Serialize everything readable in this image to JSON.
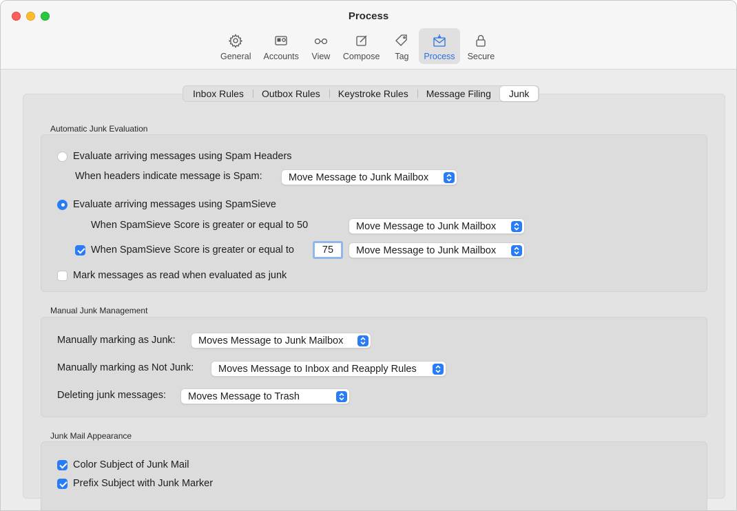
{
  "window": {
    "title": "Process"
  },
  "toolbar": {
    "items": [
      {
        "label": "General",
        "icon": "gear-icon"
      },
      {
        "label": "Accounts",
        "icon": "id-card-icon"
      },
      {
        "label": "View",
        "icon": "glasses-icon"
      },
      {
        "label": "Compose",
        "icon": "compose-icon"
      },
      {
        "label": "Tag",
        "icon": "tag-icon"
      },
      {
        "label": "Process",
        "icon": "mail-process-icon",
        "active": true
      },
      {
        "label": "Secure",
        "icon": "lock-icon"
      }
    ]
  },
  "tabs": [
    "Inbox Rules",
    "Outbox Rules",
    "Keystroke Rules",
    "Message Filing",
    "Junk"
  ],
  "active_tab": "Junk",
  "auto": {
    "heading": "Automatic Junk Evaluation",
    "spam_headers_radio": "Evaluate arriving messages using Spam Headers",
    "spam_headers_label": "When headers indicate message is Spam:",
    "spam_headers_action": "Move Message to Junk Mailbox",
    "spamsieve_radio": "Evaluate arriving messages using SpamSieve",
    "score1_label": "When SpamSieve Score is greater or equal to 50",
    "score1_action": "Move Message to Junk Mailbox",
    "score2_label": "When SpamSieve Score is greater or equal to",
    "score2_value": "75",
    "score2_action": "Move Message to Junk Mailbox",
    "mark_read": "Mark messages as read when evaluated as junk"
  },
  "manual": {
    "heading": "Manual Junk Management",
    "junk_label": "Manually marking as Junk:",
    "junk_action": "Moves Message to Junk Mailbox",
    "notjunk_label": "Manually marking as Not Junk:",
    "notjunk_action": "Moves Message to Inbox and Reapply Rules",
    "delete_label": "Deleting junk messages:",
    "delete_action": "Moves Message to Trash"
  },
  "appearance": {
    "heading": "Junk Mail Appearance",
    "color_subject": "Color Subject of Junk Mail",
    "prefix_subject": "Prefix Subject with Junk Marker"
  },
  "state": {
    "selected_radio": "spamsieve",
    "score2_checked": true,
    "mark_read_checked": false,
    "color_subject_checked": true,
    "prefix_subject_checked": true
  },
  "colors": {
    "accent": "#2a7cf6",
    "active_label": "#2a6fe0"
  }
}
